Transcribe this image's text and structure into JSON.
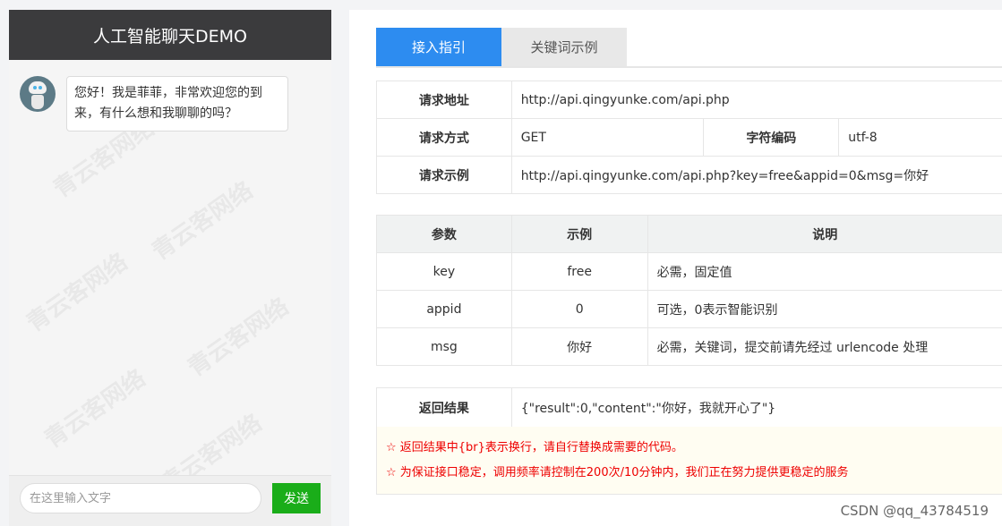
{
  "chat": {
    "title": "人工智能聊天DEMO",
    "watermark": "青云客网络",
    "messages": [
      {
        "sender": "bot",
        "text": "您好！我是菲菲，非常欢迎您的到来，有什么想和我聊聊的吗？"
      }
    ],
    "input_placeholder": "在这里输入文字",
    "send_label": "发送"
  },
  "tabs": [
    {
      "label": "接入指引",
      "active": true
    },
    {
      "label": "关键词示例",
      "active": false
    }
  ],
  "info": {
    "url_label": "请求地址",
    "url_value": "http://api.qingyunke.com/api.php",
    "method_label": "请求方式",
    "method_value": "GET",
    "charset_label": "字符编码",
    "charset_value": "utf-8",
    "example_label": "请求示例",
    "example_value": "http://api.qingyunke.com/api.php?key=free&appid=0&msg=你好"
  },
  "params": {
    "headers": [
      "参数",
      "示例",
      "说明"
    ],
    "rows": [
      {
        "name": "key",
        "example": "free",
        "desc": "必需，固定值"
      },
      {
        "name": "appid",
        "example": "0",
        "desc": "可选，0表示智能识别"
      },
      {
        "name": "msg",
        "example": "你好",
        "desc": "必需，关键词，提交前请先经过 urlencode 处理"
      }
    ]
  },
  "result": {
    "label": "返回结果",
    "value": "{\"result\":0,\"content\":\"你好，我就开心了\"}",
    "notes": [
      "☆ 返回结果中{br}表示换行，请自行替换成需要的代码。",
      "☆ 为保证接口稳定，调用频率请控制在200次/10分钟内，我们正在努力提供更稳定的服务"
    ]
  },
  "footer_watermark": "CSDN @qq_43784519",
  "colors": {
    "header_bg": "#3b3b3d",
    "tab_active": "#2d8cf0",
    "send_button": "#1aad19",
    "note_text": "#ee0000"
  }
}
